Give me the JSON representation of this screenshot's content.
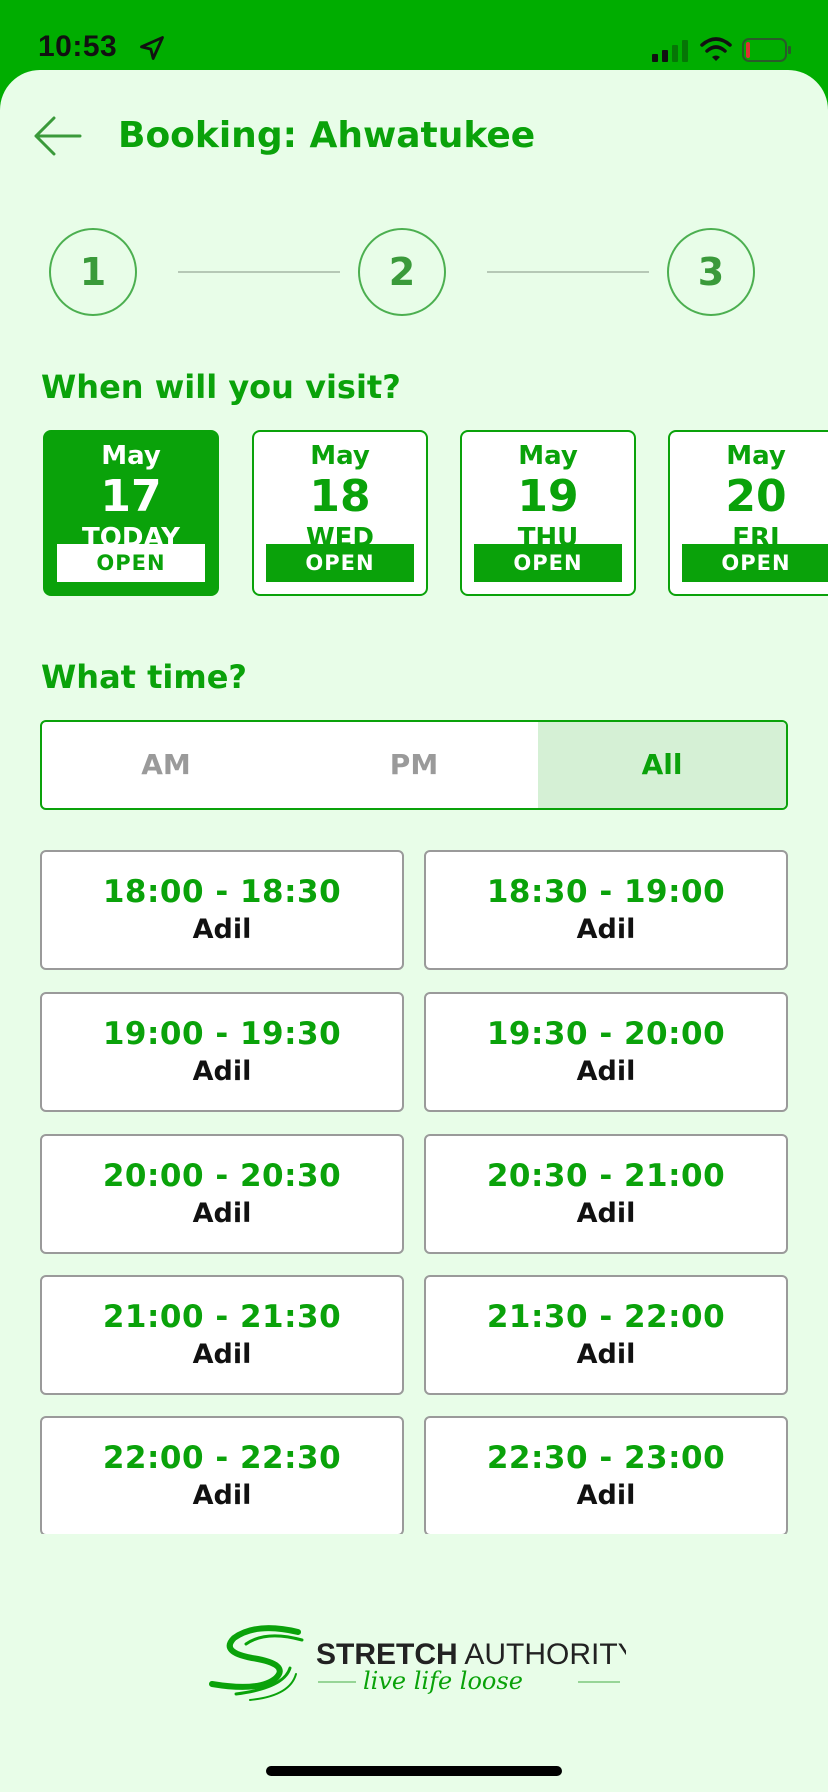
{
  "status_bar": {
    "time": "10:53",
    "icons": [
      "location-arrow-icon",
      "cellular-signal-icon",
      "wifi-icon",
      "battery-icon"
    ]
  },
  "header": {
    "back_icon": "arrow-left-icon",
    "title": "Booking: Ahwatukee"
  },
  "stepper": {
    "steps": [
      "1",
      "2",
      "3"
    ]
  },
  "date_section": {
    "title": "When will you visit?",
    "dates": [
      {
        "month": "May",
        "day": "17",
        "dow": "TODAY",
        "status": "OPEN",
        "selected": true
      },
      {
        "month": "May",
        "day": "18",
        "dow": "WED",
        "status": "OPEN",
        "selected": false
      },
      {
        "month": "May",
        "day": "19",
        "dow": "THU",
        "status": "OPEN",
        "selected": false
      },
      {
        "month": "May",
        "day": "20",
        "dow": "FRI",
        "status": "OPEN",
        "selected": false
      }
    ]
  },
  "time_section": {
    "title": "What time?",
    "filters": [
      {
        "label": "AM",
        "active": false
      },
      {
        "label": "PM",
        "active": false
      },
      {
        "label": "All",
        "active": true
      }
    ]
  },
  "slots": [
    {
      "time": "18:00 - 18:30",
      "provider": "Adil"
    },
    {
      "time": "18:30 - 19:00",
      "provider": "Adil"
    },
    {
      "time": "19:00 - 19:30",
      "provider": "Adil"
    },
    {
      "time": "19:30 - 20:00",
      "provider": "Adil"
    },
    {
      "time": "20:00 - 20:30",
      "provider": "Adil"
    },
    {
      "time": "20:30 - 21:00",
      "provider": "Adil"
    },
    {
      "time": "21:00 - 21:30",
      "provider": "Adil"
    },
    {
      "time": "21:30 - 22:00",
      "provider": "Adil"
    },
    {
      "time": "22:00 - 22:30",
      "provider": "Adil"
    },
    {
      "time": "22:30 - 23:00",
      "provider": "Adil"
    }
  ],
  "footer": {
    "brand_bold": "STRETCH",
    "brand_light": " AUTHORITY",
    "tagline": "live life loose"
  },
  "colors": {
    "brand_green": "#0aa20a",
    "status_green": "#00ad00",
    "background": "#e8fde8"
  }
}
